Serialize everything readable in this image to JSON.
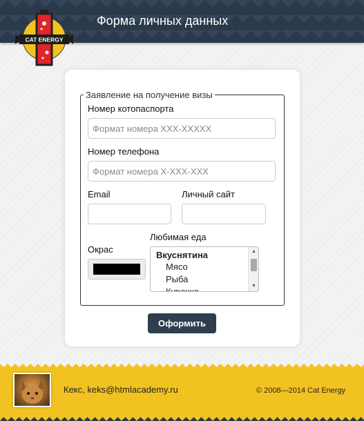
{
  "header": {
    "title": "Форма личных данных",
    "logo_text": "CAT ENERGY"
  },
  "form": {
    "legend": "Заявление на получение визы",
    "passport": {
      "label": "Номер котопаспорта",
      "placeholder": "Формат номера XXX-XXXXX",
      "value": ""
    },
    "phone": {
      "label": "Номер телефона",
      "placeholder": "Формат номера X-XXX-XXX",
      "value": ""
    },
    "email": {
      "label": "Email",
      "value": ""
    },
    "site": {
      "label": "Личный сайт",
      "value": ""
    },
    "color": {
      "label": "Окрас",
      "value": "#000000"
    },
    "food": {
      "label": "Любимая еда",
      "group": "Вкуснятина",
      "options": [
        "Мясо",
        "Рыба",
        "Курочка"
      ]
    },
    "submit_label": "Оформить"
  },
  "footer": {
    "contact": "Кекс, keks@htmlacademy.ru",
    "copyright": "© 2008—2014 Cat Energy"
  },
  "colors": {
    "header_bg": "#2b3a4a",
    "footer_bg": "#f2c320",
    "button_bg": "#2f3e4f",
    "logo_red": "#e0262a"
  }
}
